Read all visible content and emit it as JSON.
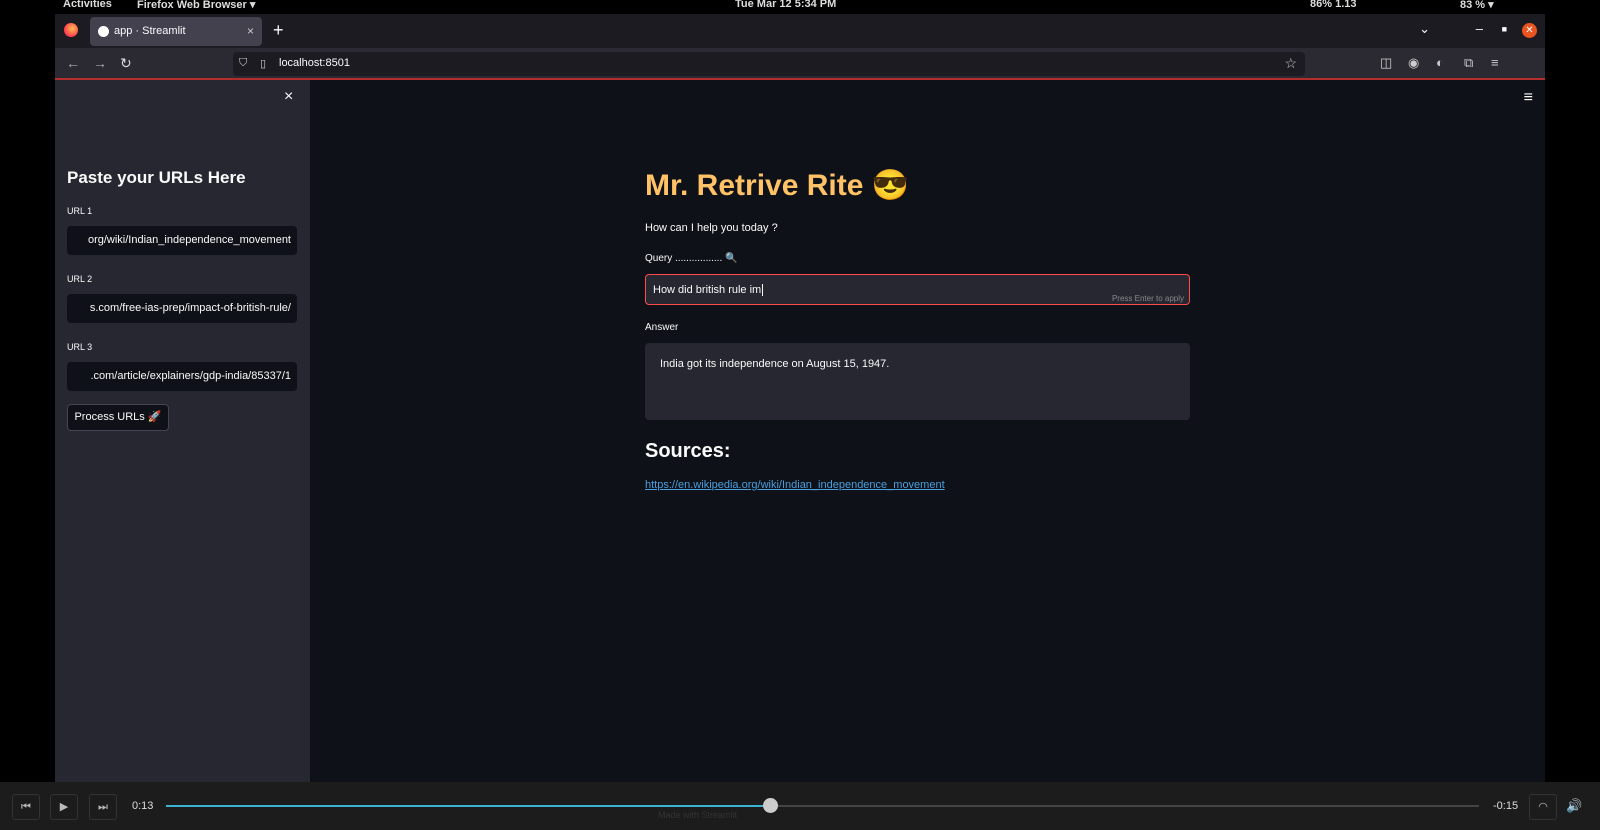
{
  "system_bar": {
    "activities": "Activities",
    "app_menu": "Firefox Web Browser ▾",
    "clock": "Tue Mar 12   5:34 PM",
    "status": "86%   1.13",
    "battery": "83 % ▾"
  },
  "browser": {
    "tab_title": "app · Streamlit",
    "tab_close": "×",
    "new_tab": "+",
    "url": "localhost:8501",
    "icons": [
      "firefox-logo",
      "back-arrow",
      "forward-arrow",
      "reload",
      "shield",
      "page",
      "star",
      "pocket",
      "account",
      "extension",
      "puzzle",
      "menu"
    ]
  },
  "sidebar": {
    "close": "×",
    "heading": "Paste your URLs Here",
    "urls": [
      {
        "label": "URL 1",
        "value": "org/wiki/Indian_independence_movement"
      },
      {
        "label": "URL 2",
        "value": "s.com/free-ias-prep/impact-of-british-rule/"
      },
      {
        "label": "URL 3",
        "value": ".com/article/explainers/gdp-india/85337/1"
      }
    ],
    "process_button": "Process URLs 🚀"
  },
  "main": {
    "title": "Mr. Retrive Rite 😎",
    "subtitle": "How can I help you today ?",
    "query_label": "Query ................. 🔍",
    "query_value": "How did british rule im",
    "query_hint": "Press Enter to apply",
    "answer_label": "Answer",
    "answer_text": "India got its independence on August 15, 1947.",
    "sources_heading": "Sources:",
    "source_link": "https://en.wikipedia.org/wiki/Indian_independence_movement",
    "menu_icon": "hamburger-menu"
  },
  "player": {
    "elapsed": "0:13",
    "remaining": "-0:15",
    "progress_fraction": 0.46,
    "footer_text": "Made with Streamlit"
  }
}
